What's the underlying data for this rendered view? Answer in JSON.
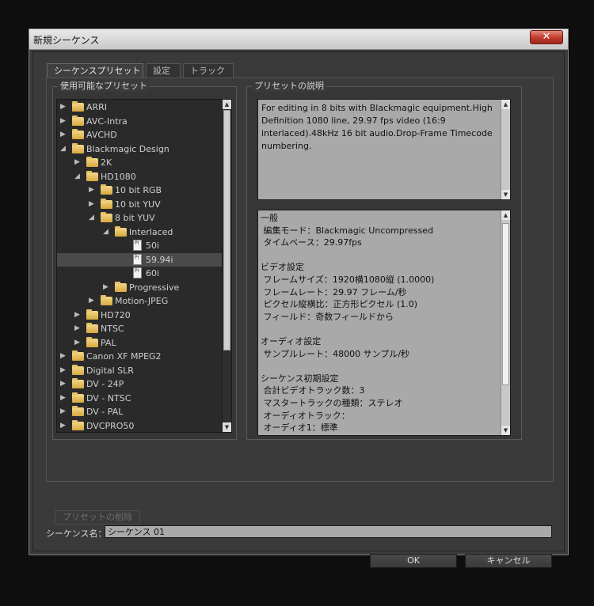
{
  "window": {
    "title": "新規シーケンス",
    "close_label": "✕"
  },
  "tabs": [
    {
      "label": "シーケンスプリセット"
    },
    {
      "label": "設定"
    },
    {
      "label": "トラック"
    }
  ],
  "presets": {
    "group_label": "使用可能なプリセット",
    "selected": "59.94i",
    "items": [
      {
        "label": "ARRI",
        "type": "folder",
        "expanded": false
      },
      {
        "label": "AVC-Intra",
        "type": "folder",
        "expanded": false
      },
      {
        "label": "AVCHD",
        "type": "folder",
        "expanded": false
      },
      {
        "label": "Blackmagic Design",
        "type": "folder",
        "expanded": true
      },
      {
        "label": "2K",
        "type": "folder",
        "expanded": false
      },
      {
        "label": "HD1080",
        "type": "folder",
        "expanded": true
      },
      {
        "label": "10 bit RGB",
        "type": "folder",
        "expanded": false
      },
      {
        "label": "10 bit YUV",
        "type": "folder",
        "expanded": false
      },
      {
        "label": "8 bit YUV",
        "type": "folder",
        "expanded": true
      },
      {
        "label": "Interlaced",
        "type": "folder",
        "expanded": true
      },
      {
        "label": "50i",
        "type": "preset"
      },
      {
        "label": "59.94i",
        "type": "preset"
      },
      {
        "label": "60i",
        "type": "preset"
      },
      {
        "label": "Progressive",
        "type": "folder",
        "expanded": false
      },
      {
        "label": "Motion-JPEG",
        "type": "folder",
        "expanded": false
      },
      {
        "label": "HD720",
        "type": "folder",
        "expanded": false
      },
      {
        "label": "NTSC",
        "type": "folder",
        "expanded": false
      },
      {
        "label": "PAL",
        "type": "folder",
        "expanded": false
      },
      {
        "label": "Canon XF MPEG2",
        "type": "folder",
        "expanded": false
      },
      {
        "label": "Digital SLR",
        "type": "folder",
        "expanded": false
      },
      {
        "label": "DV - 24P",
        "type": "folder",
        "expanded": false
      },
      {
        "label": "DV - NTSC",
        "type": "folder",
        "expanded": false
      },
      {
        "label": "DV - PAL",
        "type": "folder",
        "expanded": false
      },
      {
        "label": "DVCPRO50",
        "type": "folder",
        "expanded": false
      }
    ],
    "file_icon_text": "Pr"
  },
  "description": {
    "group_label": "プリセットの説明",
    "text": "For editing in 8 bits with Blackmagic equipment.High Definition 1080 line, 29.97 fps video (16:9 interlaced).48kHz 16 bit audio.Drop-Frame Timecode numbering."
  },
  "summary": {
    "lines": [
      "一般",
      " 編集モード：Blackmagic Uncompressed",
      " タイムベース：29.97fps",
      "",
      "ビデオ設定",
      " フレームサイズ：1920横1080縦 (1.0000)",
      " フレームレート：29.97 フレーム/秒",
      " ピクセル縦横比：正方形ピクセル (1.0)",
      " フィールド：奇数フィールドから",
      "",
      "オーディオ設定",
      " サンプルレート：48000 サンプル/秒",
      "",
      "シーケンス初期設定",
      " 合計ビデオトラック数：3",
      " マスタートラックの種類：ステレオ",
      " オーディオトラック：",
      " オーディオ1：標準"
    ]
  },
  "delete_preset_label": "プリセットの削除",
  "sequence_name": {
    "label": "シーケンス名：",
    "value": "シーケンス 01"
  },
  "buttons": {
    "ok": "OK",
    "cancel": "キャンセル"
  }
}
